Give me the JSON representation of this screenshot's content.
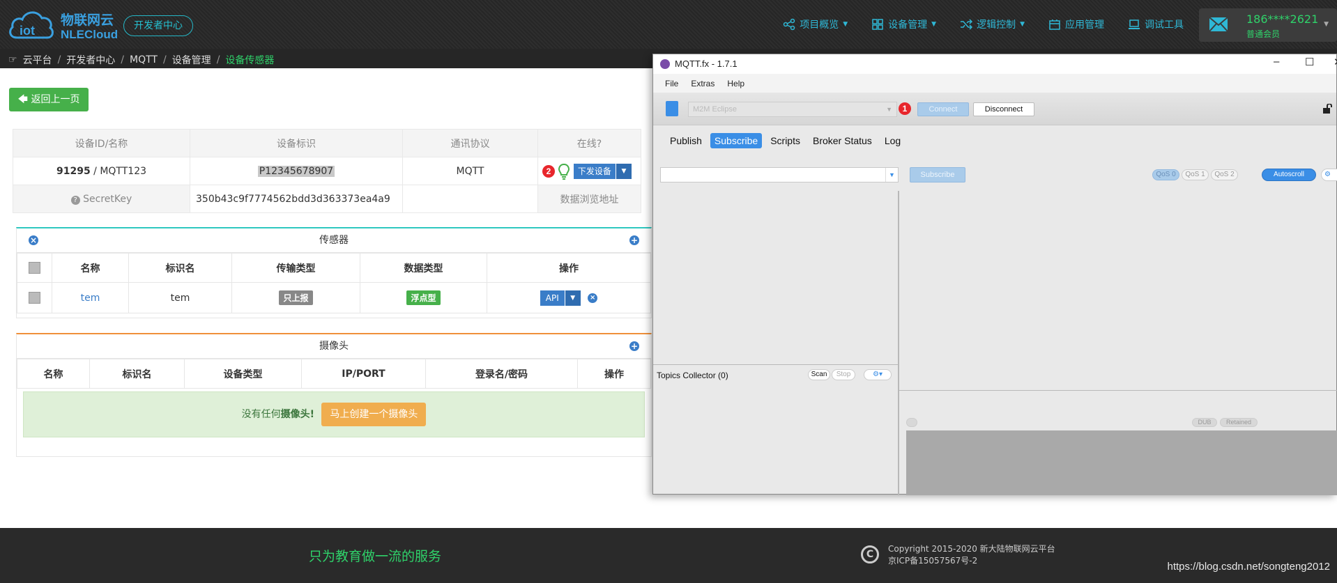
{
  "header": {
    "brand_cn": "物联网云",
    "brand_en": "NLECloud",
    "dev_center": "开发者中心",
    "nav": [
      {
        "label": "项目概览",
        "icon": "share-icon",
        "dropdown": true
      },
      {
        "label": "设备管理",
        "icon": "grid-icon",
        "dropdown": true
      },
      {
        "label": "逻辑控制",
        "icon": "shuffle-icon",
        "dropdown": true
      },
      {
        "label": "应用管理",
        "icon": "app-icon",
        "dropdown": false
      },
      {
        "label": "调试工具",
        "icon": "laptop-icon",
        "dropdown": false
      }
    ],
    "user": {
      "phone": "186****2621",
      "level": "普通会员"
    }
  },
  "breadcrumb": [
    "云平台",
    "开发者中心",
    "MQTT",
    "设备管理",
    "设备传感器"
  ],
  "back_button": "返回上一页",
  "device": {
    "headers": [
      "设备ID/名称",
      "设备标识",
      "通讯协议",
      "在线?"
    ],
    "id": "91295",
    "name": "MQTT123",
    "tag": "P12345678907",
    "protocol": "MQTT",
    "badge": "2",
    "dispatch_label": "下发设备",
    "secret_label": "SecretKey",
    "secret_value": "350b43c9f7774562bdd3d363373ea4a9",
    "browse_label": "数据浏览地址"
  },
  "sensors": {
    "title": "传感器",
    "headers": [
      "名称",
      "标识名",
      "传输类型",
      "数据类型",
      "操作"
    ],
    "rows": [
      {
        "name": "tem",
        "ident": "tem",
        "transfer": "只上报",
        "dtype": "浮点型",
        "action": "API"
      }
    ]
  },
  "cameras": {
    "title": "摄像头",
    "headers": [
      "名称",
      "标识名",
      "设备类型",
      "IP/PORT",
      "登录名/密码",
      "操作"
    ],
    "empty_prefix": "没有任何",
    "empty_bold": "摄像头!",
    "create_label": "马上创建一个摄像头"
  },
  "footer": {
    "slogan": "只为教育做一流的服务",
    "copyright_line1": "Copyright 2015-2020 新大陆物联网云平台",
    "copyright_line2": "京ICP备15057567号-2",
    "watermark": "https://blog.csdn.net/songteng2012"
  },
  "mqttfx": {
    "title": "MQTT.fx - 1.7.1",
    "menu": [
      "File",
      "Extras",
      "Help"
    ],
    "profile": "M2M Eclipse",
    "badge": "1",
    "connect": "Connect",
    "disconnect": "Disconnect",
    "tabs": [
      "Publish",
      "Subscribe",
      "Scripts",
      "Broker Status",
      "Log"
    ],
    "active_tab": "Subscribe",
    "subscribe_btn": "Subscribe",
    "qos": [
      "QoS 0",
      "QoS 1",
      "QoS 2"
    ],
    "selected_qos": "QoS 0",
    "autoscroll": "Autoscroll",
    "topics_collector": "Topics Collector (0)",
    "scan": "Scan",
    "stop": "Stop",
    "dub": "DUB",
    "retained": "Retained"
  },
  "colors": {
    "accent_green": "#46b04a",
    "accent_blue": "#3a7dc8",
    "nav_cyan": "#2fb8d6",
    "badge_red": "#e8262c"
  }
}
